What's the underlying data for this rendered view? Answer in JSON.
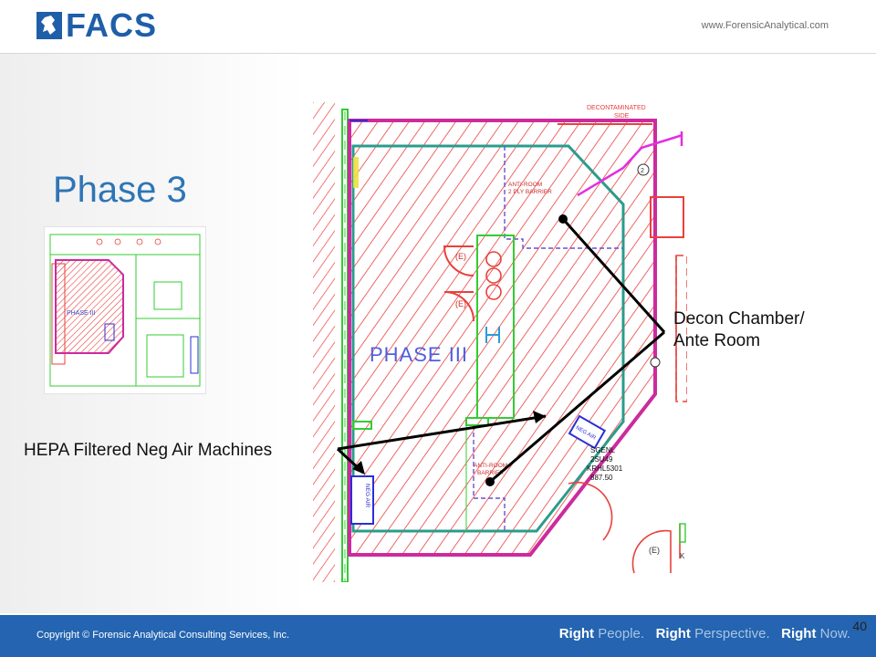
{
  "header": {
    "logo_text": "FACS",
    "site_url": "www.ForensicAnalytical.com"
  },
  "slide": {
    "title": "Phase 3",
    "callouts": {
      "decon_line1": "Decon Chamber/",
      "decon_line2": "Ante Room",
      "hepa": "HEPA Filtered Neg Air Machines"
    },
    "plan_labels": {
      "phase": "PHASE III",
      "decontaminated_side_1": "DECONTAMINATED",
      "decontaminated_side_2": "SIDE",
      "anti_room_1": "ANTI-ROOM",
      "anti_room_2": "2 PLY BARRIER",
      "anti_room_lower_1": "ANTI-ROOM",
      "anti_room_lower_2": "BARRIER",
      "neg_air_upper": "NEG AIR",
      "neg_air_lower": "NEG AIR",
      "equipment_1": "SGENL",
      "equipment_2": "2SU49",
      "equipment_3": "KRHL5301",
      "equipment_4": "887.50",
      "marker_e1": "(E)",
      "marker_e2": "(E)",
      "marker_e3": "(E)",
      "marker_2": "2",
      "marker_k": "K"
    },
    "thumbnail_label": "PHASE III"
  },
  "footer": {
    "copyright": "Copyright © Forensic Analytical Consulting Services, Inc.",
    "tag1_bold": "Right",
    "tag1_light": "People.",
    "tag2_bold": "Right",
    "tag2_light": "Perspective.",
    "tag3_bold": "Right",
    "tag3_light": "Now.",
    "page_number": "40"
  },
  "colors": {
    "brand_blue": "#1f5ea8",
    "footer_blue": "#2464b0",
    "title_blue": "#2e75b6",
    "hatch_red": "#e8413c",
    "wall_magenta": "#cc2b9d",
    "line_green": "#33cc33",
    "equipment_blue": "#2a2fd8"
  }
}
